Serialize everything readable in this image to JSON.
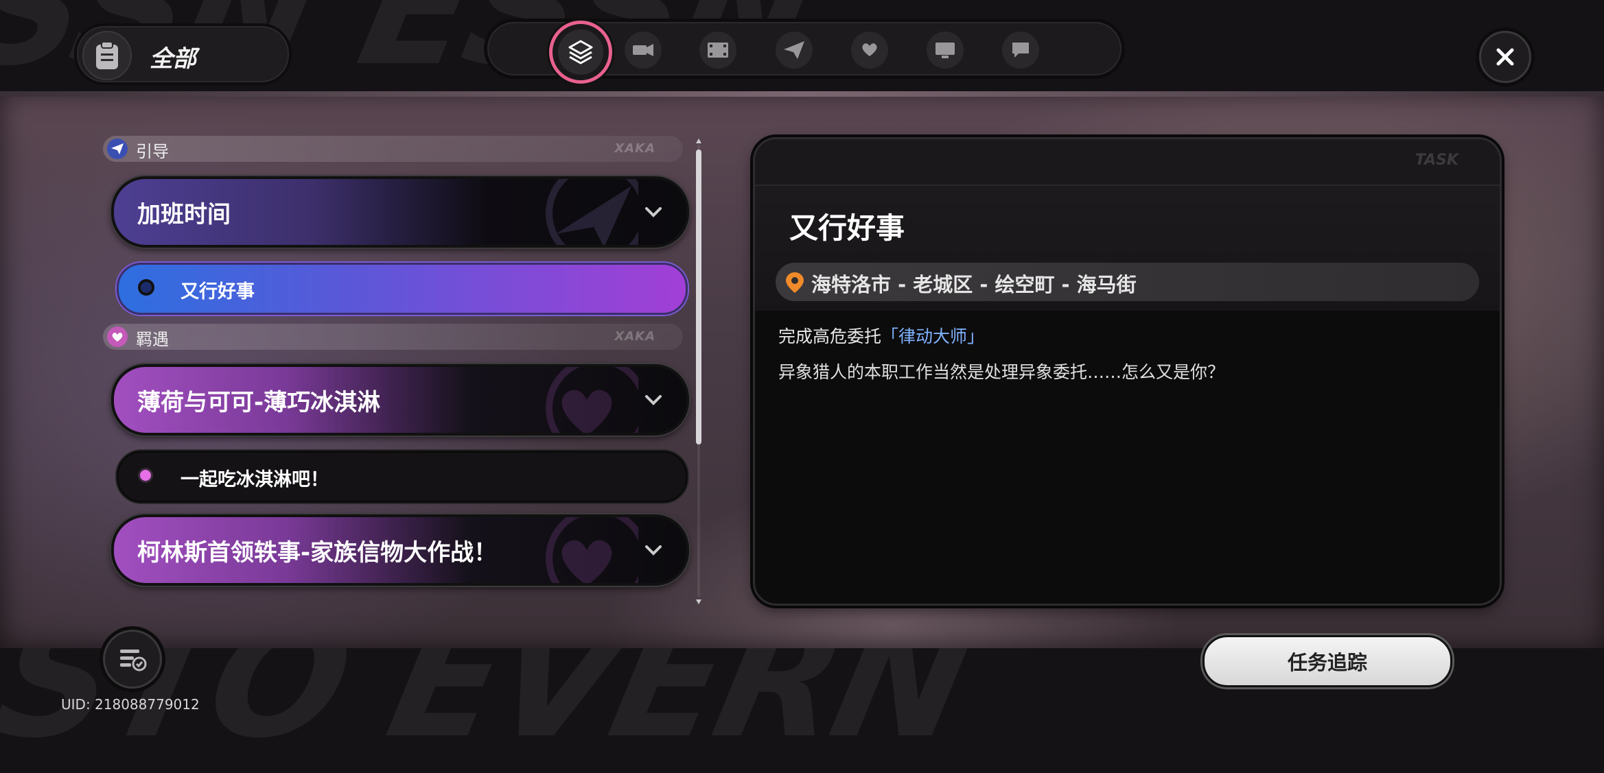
{
  "category": {
    "label": "全部",
    "icon": "clipboard-icon"
  },
  "tabs": [
    {
      "icon": "stack-layers-icon",
      "active": true
    },
    {
      "icon": "camera-icon",
      "active": false
    },
    {
      "icon": "film-icon",
      "active": false
    },
    {
      "icon": "paper-plane-icon",
      "active": false
    },
    {
      "icon": "heart-hand-icon",
      "active": false
    },
    {
      "icon": "monitor-icon",
      "active": false
    },
    {
      "icon": "chat-bubble-icon",
      "active": false
    }
  ],
  "sections": {
    "guide": {
      "title": "引导",
      "deco": "XAKA"
    },
    "encounter": {
      "title": "羁遇",
      "deco": "XAKA"
    }
  },
  "quests": {
    "overtime": {
      "title": "加班时间"
    },
    "good_deed": {
      "title": "又行好事"
    },
    "mint_cocoa": {
      "title": "薄荷与可可-薄巧冰淇淋"
    },
    "ice_cream": {
      "title": "一起吃冰淇淋吧！"
    },
    "collins": {
      "title": "柯林斯首领轶事-家族信物大作战！"
    }
  },
  "detail": {
    "deco": "TASK",
    "title": "又行好事",
    "location": "海特洛市 - 老城区 - 绘空町 - 海马街",
    "objective_prefix": "完成高危委托",
    "objective_highlight": "「律动大师」",
    "description": "异象猎人的本职工作当然是处理异象委托……怎么又是你？"
  },
  "track_button": "任务追踪",
  "uid": "UID: 218088779012",
  "colors": {
    "accent_pink": "#e9618f",
    "active_quest_start": "#2e6fe0",
    "active_quest_end": "#a23fd6",
    "highlight_blue": "#7fb2ff"
  }
}
